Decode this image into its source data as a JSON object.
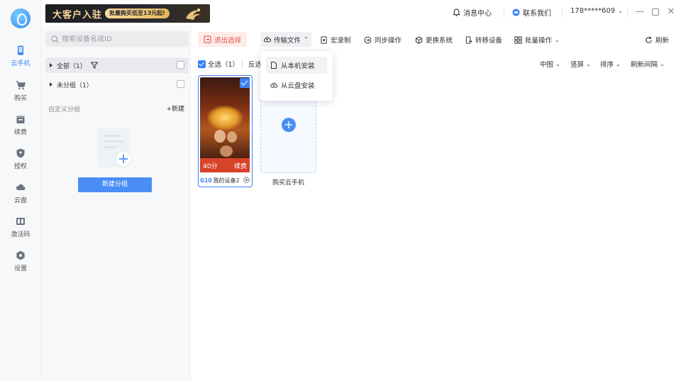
{
  "colors": {
    "accent": "#3b82f6",
    "danger": "#e8534a",
    "nav_bg": "#f7f8fa"
  },
  "nav": {
    "items": [
      {
        "label": "云手机",
        "icon": "phone-icon",
        "active": true
      },
      {
        "label": "购买",
        "icon": "cart-icon"
      },
      {
        "label": "续费",
        "icon": "renew-icon"
      },
      {
        "label": "授权",
        "icon": "shield-icon"
      },
      {
        "label": "云盘",
        "icon": "cloud-icon"
      },
      {
        "label": "激活码",
        "icon": "code-icon"
      },
      {
        "label": "设置",
        "icon": "gear-icon"
      }
    ]
  },
  "banner": {
    "title": "大客户入驻",
    "tag": "批量购买低至13元起!"
  },
  "header": {
    "messages": "消息中心",
    "contact": "联系我们",
    "account": "178*****609"
  },
  "groups": {
    "search_placeholder": "搜索设备名或ID",
    "all_label": "全部（1）",
    "ungrouped_label": "未分组（1）",
    "custom_label": "自定义分组",
    "new_link": "+新建",
    "new_group_button": "新建分组"
  },
  "toolbar": {
    "exit_select": "退出选择",
    "transfer": "传输文件",
    "macro": "宏录制",
    "sync": "同步操作",
    "change_system": "更换系统",
    "move_device": "转移设备",
    "batch": "批量操作",
    "refresh": "刷新"
  },
  "viewbar": {
    "select_all": "全选（1）",
    "invert": "反选",
    "size": "中图",
    "orientation": "竖屏",
    "sort": "排序",
    "refresh_interval": "刷新间隔"
  },
  "dropdown": {
    "local_install": "从本机安装",
    "cloud_install": "从云盘安装"
  },
  "device": {
    "time_left": "40分",
    "renew": "续费",
    "badge": "G10",
    "name": "我的设备2"
  },
  "buy": {
    "label": "购买云手机"
  }
}
